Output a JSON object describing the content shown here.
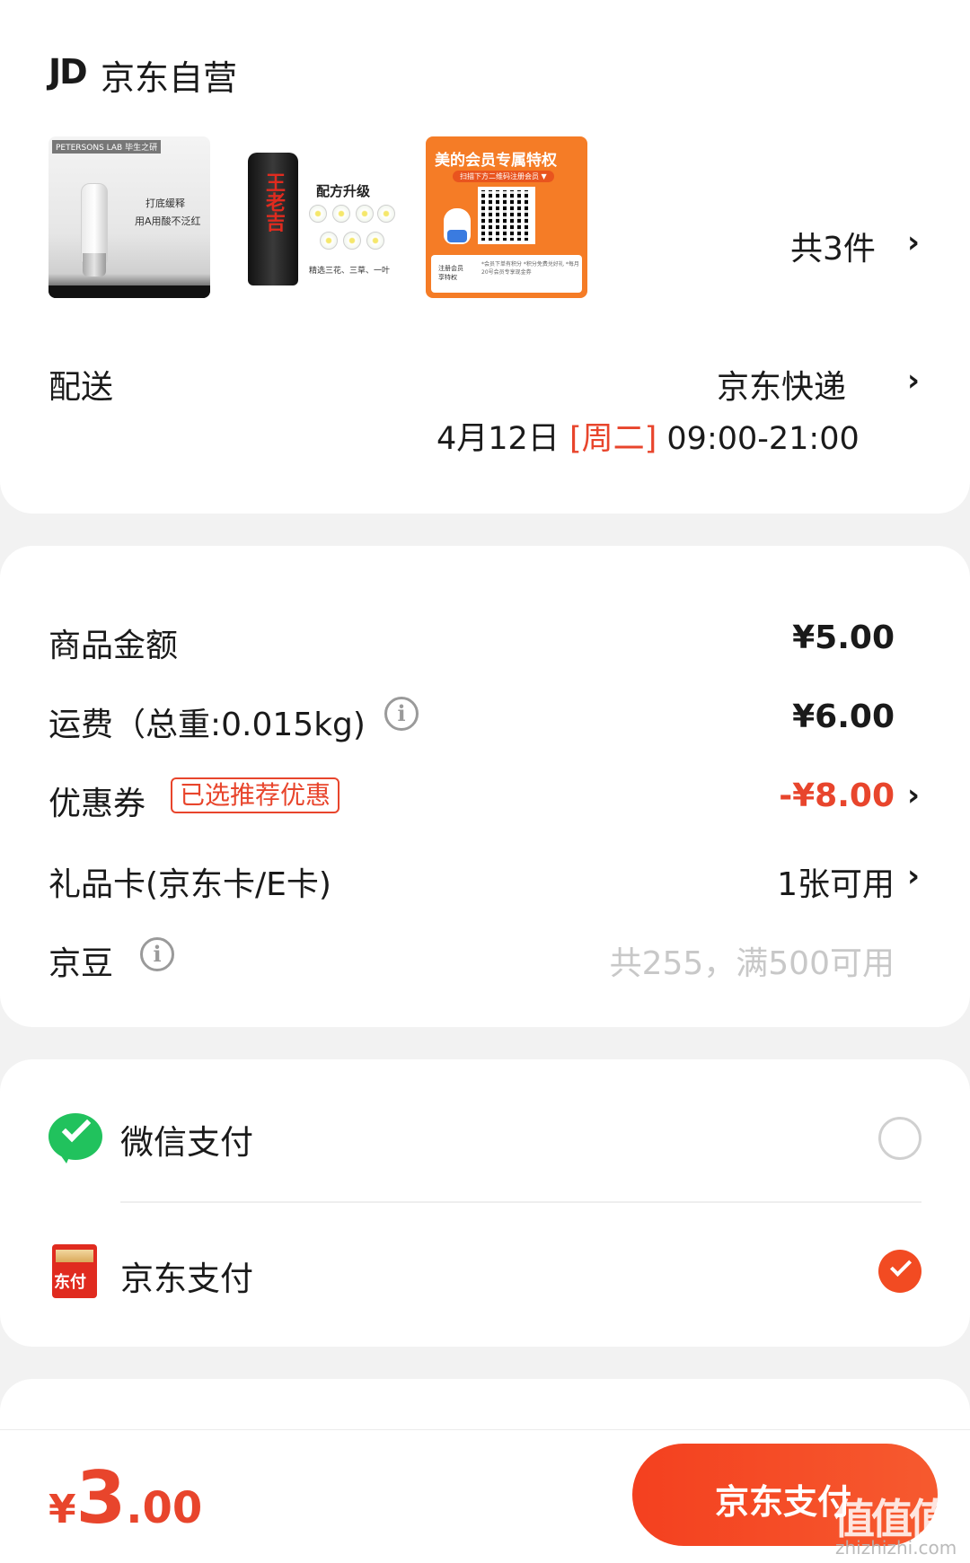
{
  "store": {
    "logo": "JD",
    "name": "京东自营"
  },
  "products": {
    "count_label": "共3件",
    "thumb1": {
      "brand": "PETERSONS LAB 毕生之研",
      "line1": "打底缓释",
      "line2": "用A用酸不泛红"
    },
    "thumb2": {
      "can_label": "王老吉",
      "title": "配方升级",
      "footer": "精选三花、三草、一叶"
    },
    "thumb3": {
      "title": "美的会员专属特权",
      "sub": "扫描下方二维码注册会员 ▼",
      "panel_left": "注册会员享特权",
      "panel_right": "*会员下单有积分 *积分免费兑好礼 *每月20号会员专享现金券"
    }
  },
  "delivery": {
    "label": "配送",
    "method": "京东快递",
    "date": "4月12日",
    "weekday": "[周二]",
    "time": "09:00-21:00"
  },
  "costs": {
    "goods_label": "商品金额",
    "goods_value": "¥5.00",
    "shipping_label": "运费（总重:0.015kg)",
    "shipping_value": "¥6.00",
    "coupon_label": "优惠券",
    "coupon_tag": "已选推荐优惠",
    "coupon_value": "-¥8.00",
    "giftcard_label": "礼品卡(京东卡/E卡)",
    "giftcard_value": "1张可用",
    "beans_label": "京豆",
    "beans_value": "共255，满500可用"
  },
  "payment": {
    "wechat_label": "微信支付",
    "jd_label": "京东支付",
    "jd_icon_text": "东付",
    "selected": "京东支付"
  },
  "footer": {
    "total_yen": "¥",
    "total_int": "3",
    "total_dec": ".00",
    "pay_button": "京东支付",
    "watermark": "值值值",
    "watermark_url": "zhizhizhi.com"
  },
  "icons": {
    "info": "info-icon",
    "chevron": "chevron-right-icon",
    "wechat": "wechat-pay-icon",
    "jdpay": "jd-pay-icon"
  },
  "colors": {
    "accent": "#e8452c",
    "button": "#f4401f",
    "wechat": "#21c25d"
  }
}
